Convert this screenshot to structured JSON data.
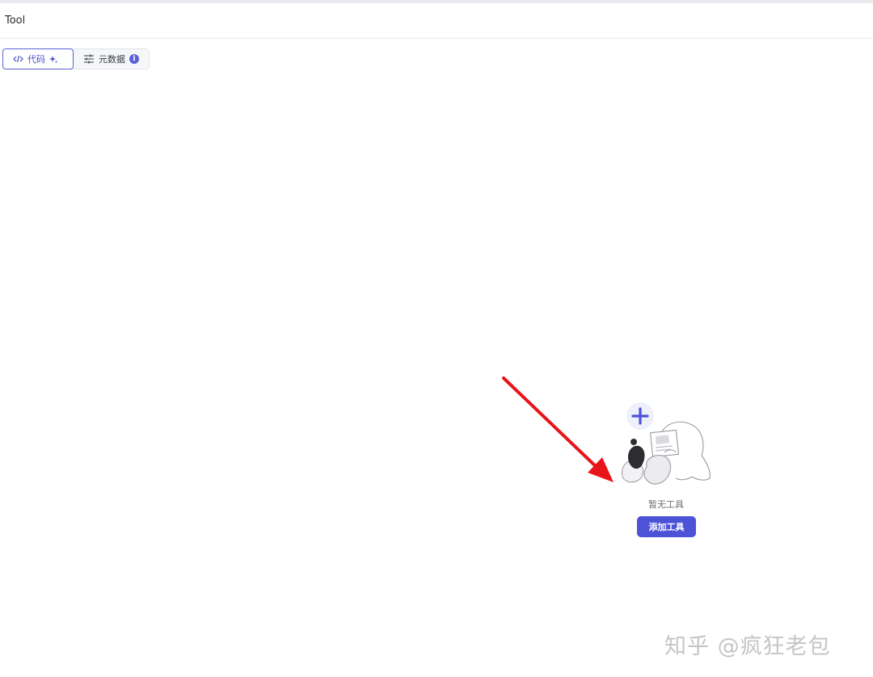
{
  "header": {
    "title": "Tool"
  },
  "tabs": [
    {
      "label": "代码",
      "icon": "code-icon",
      "badge_icon": "sparkle-icon",
      "active": true
    },
    {
      "label": "元数据",
      "icon": "sliders-icon",
      "badge_icon": "info-icon",
      "active": false,
      "badge_text": "i"
    }
  ],
  "empty_state": {
    "illustration": "person-with-plus-and-document-illustration",
    "message": "暂无工具",
    "button_label": "添加工具"
  },
  "annotation": {
    "type": "red-arrow",
    "color": "#e8141a"
  },
  "watermark": {
    "text": "知乎 @疯狂老包"
  },
  "colors": {
    "accent": "#4d53d6",
    "active_tab_border": "#5b61d6",
    "arrow": "#e8141a"
  }
}
